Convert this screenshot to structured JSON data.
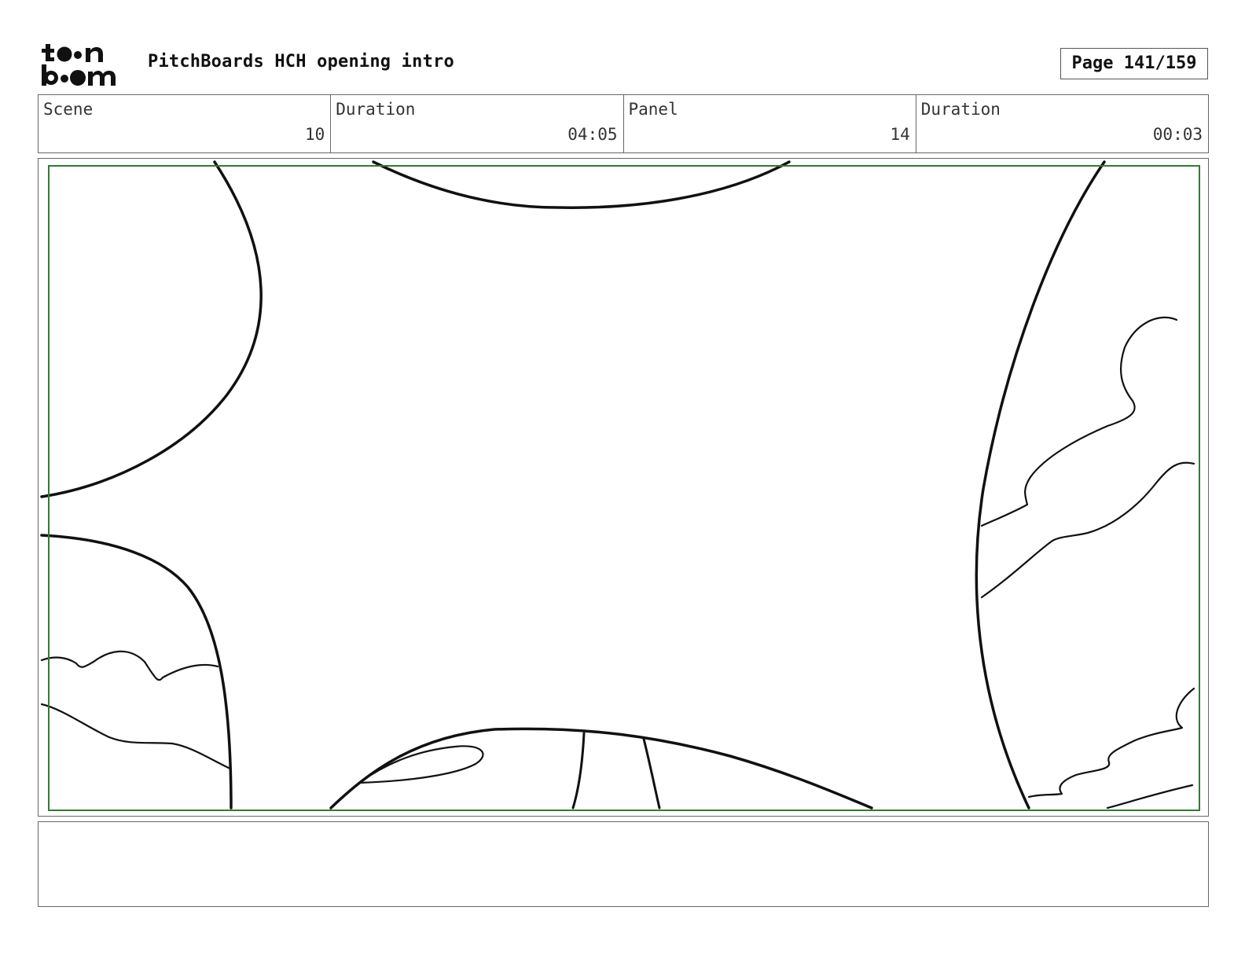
{
  "header": {
    "logo_text": "toon boom",
    "doc_title": "PitchBoards HCH opening intro",
    "page_label": "Page 141/159"
  },
  "info": {
    "scene_label": "Scene",
    "scene_value": "10",
    "scene_duration_label": "Duration",
    "scene_duration_value": "04:05",
    "panel_label": "Panel",
    "panel_value": "14",
    "panel_duration_label": "Duration",
    "panel_duration_value": "00:03"
  },
  "colors": {
    "safe_frame": "#2e7d32",
    "ink": "#111111"
  },
  "notes": {
    "text": ""
  }
}
